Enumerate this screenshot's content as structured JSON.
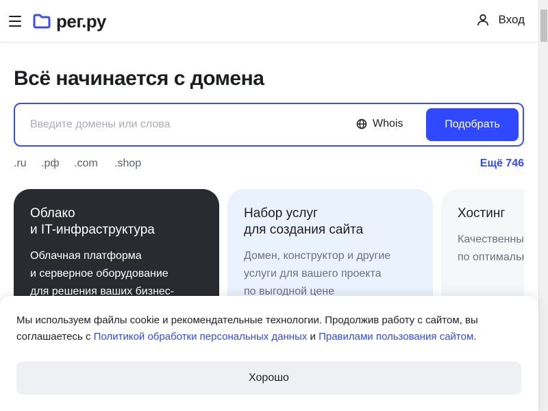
{
  "header": {
    "logo_text": "рег.ру",
    "login_label": "Вход"
  },
  "hero": {
    "title": "Всё начинается с домена"
  },
  "search": {
    "placeholder": "Введите домены или слова",
    "whois_label": "Whois",
    "button_label": "Подобрать"
  },
  "zones": {
    "items": [
      ".ru",
      ".рф",
      ".com",
      ".shop"
    ],
    "more_label": "Ещё 746"
  },
  "cards": [
    {
      "title": "Облако\nи IT-инфраструктура",
      "description": "Облачная платформа\nи серверное оборудование\nдля решения ваших бизнес-"
    },
    {
      "title": "Набор услуг\nдля создания сайта",
      "description": "Домен, конструктор и другие\nуслуги для вашего проекта\nпо выгодной цене"
    },
    {
      "title": "Хостинг",
      "description": "Качественный\nпо оптимальн"
    }
  ],
  "cookie": {
    "text_part1": "Мы используем файлы cookie и рекомендательные технологии. Продолжив работу с сайтом, вы соглашаетесь с ",
    "link_privacy": "Политикой обработки персональных данных",
    "text_and": " и ",
    "link_terms": "Правилами пользования сайтом",
    "text_end": ".",
    "ok_label": "Хорошо"
  },
  "colors": {
    "accent": "#3049ff",
    "logo_icon": "#3b4ee8",
    "card_dark": "#292b31",
    "card_blue": "#eaf2fe",
    "card_light": "#f6f7f9"
  },
  "icons": {
    "menu": "menu-icon",
    "logo": "folder-icon",
    "login": "user-icon",
    "whois": "globe-icon"
  }
}
